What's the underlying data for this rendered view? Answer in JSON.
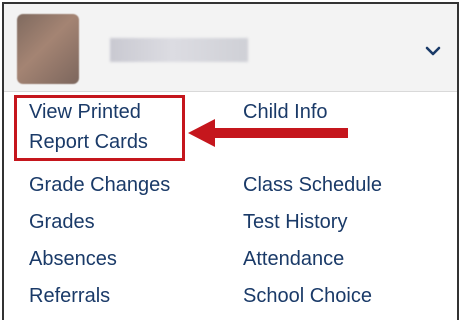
{
  "header": {
    "avatar_icon": "child-photo",
    "chevron_icon": "chevron-down-icon"
  },
  "highlight": {
    "item": {
      "line1": "View Printed",
      "line2": "Report Cards"
    },
    "arrow_icon": "arrow-left-icon",
    "color": "#c5161d"
  },
  "menu": {
    "child_info": "Child Info",
    "left": [
      "Grade Changes",
      "Grades",
      "Absences",
      "Referrals"
    ],
    "right": [
      "Class Schedule",
      "Test History",
      "Attendance",
      "School Choice"
    ]
  },
  "colors": {
    "link": "#1a3a68",
    "header_bg": "#f3f3f3"
  }
}
